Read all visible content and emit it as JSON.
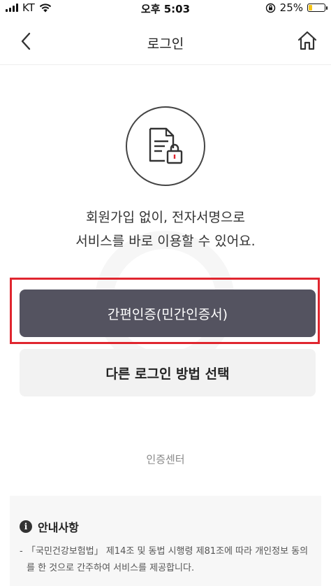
{
  "status_bar": {
    "carrier": "KT",
    "time": "오후 5:03",
    "battery": "25%",
    "battery_level": 0.25
  },
  "nav": {
    "title": "로그인",
    "back_icon": "chevron-left-icon",
    "home_icon": "home-icon"
  },
  "hero": {
    "icon": "document-lock-icon",
    "line1": "회원가입 없이, 전자서명으로",
    "line2": "서비스를 바로 이용할 수 있어요."
  },
  "buttons": {
    "primary_label": "간편인증(민간인증서)",
    "secondary_label": "다른 로그인 방법 선택"
  },
  "links": {
    "cert_center": "인증센터"
  },
  "notice": {
    "title": "안내사항",
    "item1": "「국민건강보험법」 제14조 및 동법 시행령 제81조에 따라 개인정보 동의를 한 것으로 간주하여 서비스를 제공합니다."
  },
  "colors": {
    "primary_button": "#545360",
    "secondary_button": "#f2f2f2",
    "highlight": "#e0262f"
  }
}
